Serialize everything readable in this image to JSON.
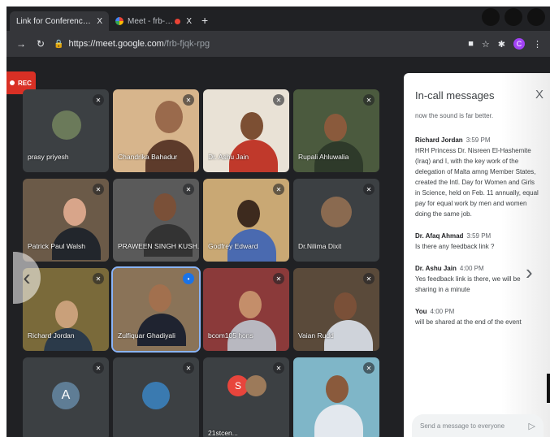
{
  "browser": {
    "tabs": [
      {
        "label": "Link for Conference - chitransh",
        "close": "X"
      },
      {
        "label": "Meet - frb-fjqk-rpg",
        "close": "X"
      }
    ],
    "new_tab": "+",
    "url_host": "https://meet.google.com",
    "url_path": "/frb-fjqk-rpg",
    "profile_initial": "C"
  },
  "meet": {
    "rec_label": "REC",
    "tiles": [
      {
        "name": "prasy priyesh",
        "mic": "muted"
      },
      {
        "name": "Chandrika Bahadur",
        "mic": "muted"
      },
      {
        "name": "Dr. Ashu Jain",
        "mic": "muted"
      },
      {
        "name": "Rupali Ahluwalia",
        "mic": "muted"
      },
      {
        "name": "Patrick Paul Walsh",
        "mic": "muted"
      },
      {
        "name": "PRAWEEN SINGH KUSH...",
        "mic": "muted"
      },
      {
        "name": "Godfrey Edward",
        "mic": "muted"
      },
      {
        "name": "Dr.Nilima Dixit",
        "mic": "muted"
      },
      {
        "name": "Richard Jordan",
        "mic": "muted"
      },
      {
        "name": "Zulfiquar Ghadiyali",
        "mic": "speaking"
      },
      {
        "name": "bcom105 hons",
        "mic": "muted"
      },
      {
        "name": "Vaian Rudd",
        "mic": "muted"
      },
      {
        "name": "",
        "mic": "muted",
        "initial": "A"
      },
      {
        "name": "",
        "mic": "muted"
      },
      {
        "name": "21stcen...",
        "mic": "muted",
        "initial": "S"
      },
      {
        "name": "",
        "mic": "muted"
      }
    ]
  },
  "chat": {
    "title": "In-call messages",
    "close": "X",
    "truncated_top": "now the sound is far better.",
    "messages": [
      {
        "sender": "Richard Jordan",
        "time": "3:59 PM",
        "text": "HRH Princess Dr. Nisreen El-Hashemite (Iraq) and I, with the key work of the delegation of Malta amng Member States, created the Intl. Day for Women and Girls in Science, held on Feb. 11 annually, equal pay for equal work by men and women doing the same job."
      },
      {
        "sender": "Dr. Afaq Ahmad",
        "time": "3:59 PM",
        "text": "Is there any feedback link ?"
      },
      {
        "sender": "Dr. Ashu Jain",
        "time": "4:00 PM",
        "text": "Yes feedback link is there, we will be sharing in a minute"
      },
      {
        "sender": "You",
        "time": "4:00 PM",
        "text": "will be shared at the end of the event"
      }
    ],
    "input_placeholder": "Send a message to everyone"
  }
}
